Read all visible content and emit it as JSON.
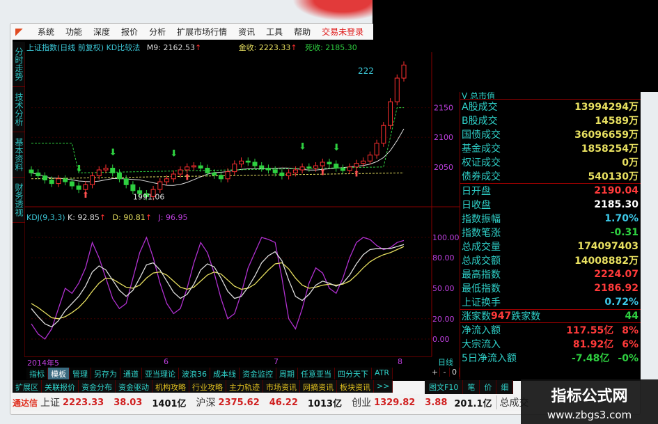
{
  "menu": {
    "items": [
      "系统",
      "功能",
      "深度",
      "报价",
      "分析",
      "扩展市场行情",
      "资讯",
      "工具",
      "帮助"
    ],
    "login": "交易未登录"
  },
  "side_tabs": [
    "分时走势",
    "技术分析",
    "基本资料",
    "财务透视"
  ],
  "info": {
    "title": "上证指数(日线 前复权) KD比较法",
    "m9": "M9: 2162.53",
    "jin": "金收: 2223.33",
    "si": "死收: 2185.30",
    "top_price": "222"
  },
  "kdj": {
    "name": "KDJ(9,3,3)",
    "k": "K: 92.85",
    "d": "D: 90.81",
    "j": "J: 96.95"
  },
  "price_axis": [
    "2150",
    "2100",
    "2050"
  ],
  "kdj_axis": [
    "100.00",
    "80.00",
    "50.00",
    "20.00",
    "0.00"
  ],
  "annotation_low": "1991.06",
  "date_axis": [
    "2014年5",
    "6",
    "7",
    "8"
  ],
  "period_label": "日线",
  "chart_data": {
    "type": "candlestick+line",
    "closes": [
      2040,
      2035,
      2028,
      2022,
      2030,
      2025,
      2018,
      2012,
      2020,
      2035,
      2045,
      2048,
      2040,
      2030,
      2020,
      2010,
      2005,
      2000,
      2012,
      2025,
      2030,
      2038,
      2045,
      2050,
      2052,
      2048,
      2040,
      2036,
      2030,
      2042,
      2055,
      2060,
      2058,
      2052,
      2048,
      2045,
      2040,
      2035,
      2040,
      2045,
      2050,
      2048,
      2052,
      2058,
      2055,
      2048,
      2044,
      2050,
      2056,
      2060,
      2070,
      2090,
      2120,
      2160,
      2200,
      2222
    ],
    "price_range": [
      1991,
      2226
    ],
    "K": [
      30,
      22,
      15,
      12,
      18,
      28,
      35,
      42,
      52,
      66,
      72,
      68,
      58,
      48,
      42,
      48,
      60,
      73,
      75,
      68,
      57,
      46,
      40,
      44,
      54,
      68,
      74,
      71,
      60,
      47,
      40,
      42,
      51,
      62,
      75,
      82,
      86,
      77,
      58,
      42,
      38,
      44,
      53,
      57,
      55,
      52,
      55,
      63,
      74,
      83,
      88,
      89,
      89,
      89,
      91,
      93
    ],
    "D": [
      35,
      31,
      26,
      21,
      20,
      22,
      26,
      31,
      38,
      47,
      55,
      60,
      59,
      55,
      51,
      50,
      53,
      60,
      65,
      66,
      63,
      57,
      51,
      49,
      51,
      57,
      63,
      66,
      64,
      58,
      52,
      49,
      50,
      54,
      61,
      68,
      74,
      75,
      69,
      60,
      53,
      50,
      51,
      53,
      54,
      53,
      54,
      57,
      63,
      70,
      76,
      80,
      83,
      85,
      88,
      91
    ],
    "J": [
      15,
      5,
      0,
      10,
      30,
      50,
      45,
      55,
      70,
      95,
      80,
      60,
      40,
      30,
      35,
      60,
      85,
      100,
      80,
      55,
      35,
      25,
      30,
      50,
      75,
      95,
      85,
      65,
      40,
      20,
      25,
      45,
      70,
      85,
      100,
      98,
      95,
      60,
      20,
      10,
      30,
      55,
      70,
      65,
      50,
      45,
      60,
      80,
      95,
      100,
      98,
      92,
      88,
      90,
      95,
      97
    ],
    "kdj_range": [
      -10,
      110
    ]
  },
  "panel": {
    "top_partial": "V 总市值",
    "group1": [
      {
        "label": "A股成交",
        "value": "13994294万"
      },
      {
        "label": "B股成交",
        "value": "14589万"
      },
      {
        "label": "国债成交",
        "value": "36096659万"
      },
      {
        "label": "基金成交",
        "value": "1858254万"
      },
      {
        "label": "权证成交",
        "value": "0万"
      },
      {
        "label": "债券成交",
        "value": "540130万"
      }
    ],
    "group2": [
      {
        "label": "日开盘",
        "value": "2190.04",
        "color": "#ff3a3a"
      },
      {
        "label": "日收盘",
        "value": "2185.30",
        "color": "#ffffff"
      },
      {
        "label": "指数振幅",
        "value": "1.70%",
        "color": "#3cc8e8"
      },
      {
        "label": "指数笔涨",
        "value": "-0.31",
        "color": "#2ed040"
      },
      {
        "label": "总成交量",
        "value": "174097403",
        "color": "#e8e060"
      },
      {
        "label": "总成交额",
        "value": "14008882万",
        "color": "#e8e060"
      },
      {
        "label": "最高指数",
        "value": "2224.07",
        "color": "#ff3a3a"
      },
      {
        "label": "最低指数",
        "value": "2186.92",
        "color": "#ff3a3a"
      },
      {
        "label": "上证换手",
        "value": "0.72%",
        "color": "#3cc8e8"
      }
    ],
    "up_label": "涨家数",
    "up": "947",
    "down_label": "跌家数",
    "down": "44",
    "flows": [
      {
        "label": "净流入额",
        "value": "117.55亿",
        "pct": "8%",
        "color": "#ff3a3a"
      },
      {
        "label": "大宗流入",
        "value": "81.92亿",
        "pct": "6%",
        "color": "#ff3a3a"
      },
      {
        "label": "5日净流入额",
        "value": "-7.48亿",
        "pct": "-0%",
        "color": "#2ed040"
      }
    ]
  },
  "tabs1": [
    "指标",
    "模板",
    "管理",
    "另存为",
    "通道",
    "亚当理论",
    "波浪36",
    "成本线",
    "资金监控",
    "周期",
    "任意亚当",
    "四分天下",
    "ATR"
  ],
  "plusminus": [
    "+",
    "-",
    "0"
  ],
  "tabs2": [
    {
      "l": "扩展区",
      "c": "#2fd0c8"
    },
    {
      "l": "关联报价",
      "c": "#2fd0c8"
    },
    {
      "l": "资金分布",
      "c": "#2fd0c8"
    },
    {
      "l": "资金驱动",
      "c": "#2fd0c8"
    },
    {
      "l": "机构攻略",
      "c": "#e0c020"
    },
    {
      "l": "行业攻略",
      "c": "#e0c020"
    },
    {
      "l": "主力轨迹",
      "c": "#e0c020"
    },
    {
      "l": "市场资讯",
      "c": "#e0c020"
    },
    {
      "l": "网摘资讯",
      "c": "#e0c020"
    },
    {
      "l": "板块资讯",
      "c": "#e0c020"
    },
    {
      "l": ">>",
      "c": "#2fd0c8"
    }
  ],
  "tabs3": [
    "图文F10",
    "笔",
    "价",
    "细"
  ],
  "status": {
    "brand": "通达信",
    "sh_label": "上证",
    "sh": "2223.33",
    "sh_chg": "38.03",
    "sh_amt": "1401亿",
    "hs_label": "沪深",
    "hs": "2375.62",
    "hs_chg": "46.22",
    "hs_amt": "1013亿",
    "cy_label": "创业",
    "cy": "1329.82",
    "cy_chg": "3.88",
    "cy_amt": "201.1亿",
    "more": "总成交"
  },
  "watermark": {
    "title": "指标公式网",
    "url": "www.zbgs3.com"
  }
}
